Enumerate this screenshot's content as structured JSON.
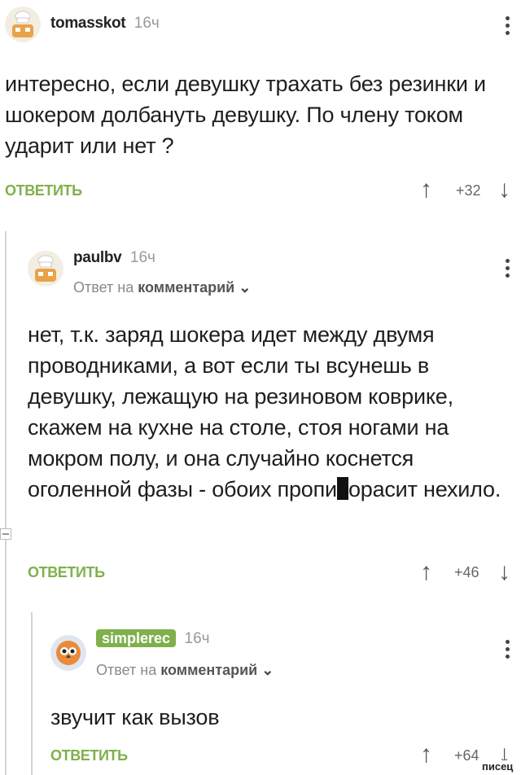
{
  "comments": [
    {
      "username": "tomasskot",
      "time": "16ч",
      "text": "интересно, если девушку трахать без резинки и шокером долбануть девушку. По члену током ударит или нет ?",
      "reply_label": "ОТВЕТИТЬ",
      "score": "+32"
    },
    {
      "username": "paulbv",
      "time": "16ч",
      "reply_to_prefix": "Ответ на",
      "reply_to_target": "комментарий",
      "text_before": "нет, т.к. заряд шокера идет между двумя проводниками, а вот если ты всунешь в девушку, лежащую на резиновом коврике, скажем на кухне на столе, стоя ногами на мокром полу, и она случайно коснется оголенной фазы - обоих пропи",
      "text_after": "орасит нехило.",
      "reply_label": "ОТВЕТИТЬ",
      "score": "+46"
    },
    {
      "username": "simplerec",
      "time": "16ч",
      "reply_to_prefix": "Ответ на",
      "reply_to_target": "комментарий",
      "text": "звучит как вызов",
      "reply_label": "ОТВЕТИТЬ",
      "score": "+64"
    }
  ],
  "icons": {
    "upvote": "↑",
    "downvote": "↓",
    "chevron": "⌄"
  },
  "watermark": "писец",
  "colors": {
    "accent": "#7fb04b",
    "text": "#1e1e1e",
    "muted": "#9a9a9a"
  }
}
